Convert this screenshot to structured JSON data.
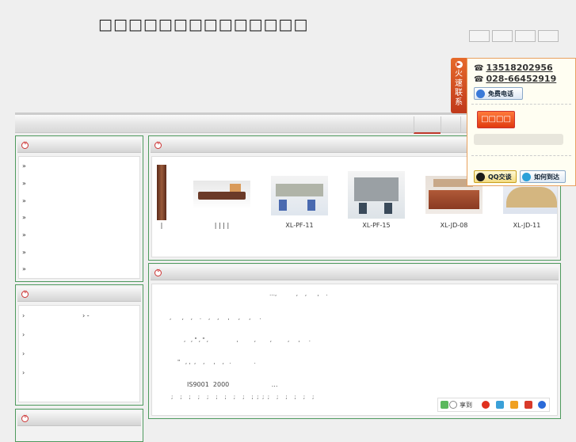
{
  "header": {
    "site_title": "□□□□□□□□□□□□□□",
    "top_buttons": [
      "",
      "",
      "",
      ""
    ]
  },
  "nav": {
    "tabs": [
      "",
      "",
      ""
    ]
  },
  "sidebar": {
    "panel1": {
      "title": "",
      "items": [
        "»",
        "»",
        "»",
        "»",
        "»",
        "»",
        "»"
      ]
    },
    "panel2": {
      "title": "",
      "items": [
        "›",
        "› -",
        "›",
        "›",
        "›"
      ]
    },
    "panel3": {
      "title": ""
    }
  },
  "products": {
    "title": "",
    "items": [
      {
        "label": "|",
        "color": "#7a3a20"
      },
      {
        "label": "|  |  |  |",
        "color": "#6b4a3a"
      },
      {
        "label": "XL-PF-11",
        "color": "#7a9ac8"
      },
      {
        "label": "XL-PF-15",
        "color": "#8aa0b0"
      },
      {
        "label": "XL-JD-08",
        "color": "#a05a3a"
      },
      {
        "label": "XL-JD-11",
        "color": "#c8b080"
      }
    ]
  },
  "intro": {
    "title": "",
    "lines": [
      "…,           ,    ,      ,    .",
      ",      ,    ,    .    ,    ,     ,     ,     ,     .",
      ",   , \" , \" ,                ,         ,        ,         ,     ,     .",
      "\"   , ,  ,    ,     ,    ,   .             .",
      "IS9001  2000                     …",
      ";    ;    ;    ;    ;    ;    ;    ;    ;    ;  ;  ;  ;    ;    ;    ;    ;    ;"
    ],
    "share_label": "享到"
  },
  "contact": {
    "tab_text": "火速联系",
    "phone1": "13518202956",
    "phone2": "028-66452919",
    "free_call": "免费电话",
    "order_btn": "□□□□",
    "qq_btn": "QQ交谈",
    "route_btn": "如何到达"
  }
}
